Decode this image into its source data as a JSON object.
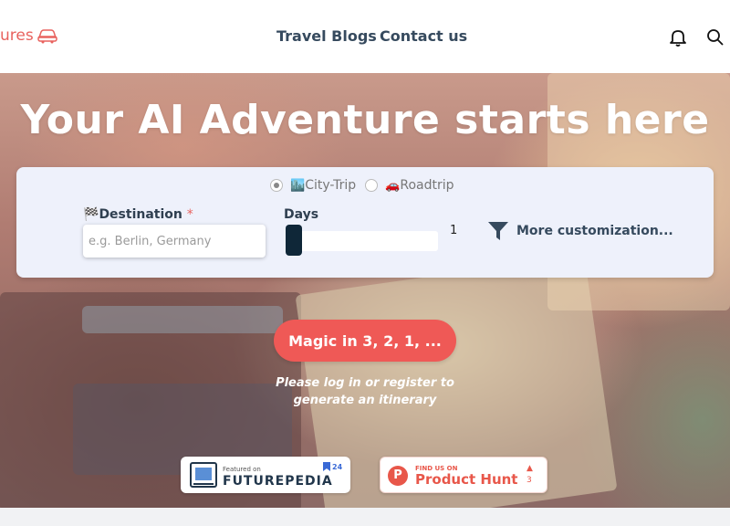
{
  "header": {
    "logo_text": "ures",
    "nav": {
      "blogs": "Travel Blogs",
      "contact": "Contact us"
    },
    "icons": [
      "bell-icon",
      "search-icon"
    ]
  },
  "hero": {
    "title": "Your AI Adventure starts here",
    "trip_type": {
      "options": [
        {
          "emoji": "🏙️",
          "label": "City-Trip",
          "selected": true
        },
        {
          "emoji": "🚗",
          "label": "Roadtrip",
          "selected": false
        }
      ]
    },
    "destination": {
      "emoji": "🏁",
      "label": "Destination",
      "required_mark": "*",
      "placeholder": "e.g. Berlin, Germany",
      "value": ""
    },
    "days": {
      "label": "Days",
      "value": "1"
    },
    "more_customization": "More customization...",
    "magic_button": "Magic in 3, 2, 1, ...",
    "login_note_line1": "Please log in or register to",
    "login_note_line2": "generate an itinerary",
    "badges": {
      "futurepedia": {
        "small": "Featured on",
        "big": "FUTUREPEDIA",
        "count": "24"
      },
      "producthunt": {
        "small": "FIND US ON",
        "big": "Product Hunt",
        "letter": "P",
        "arrow": "▲",
        "count": "3"
      }
    }
  },
  "colors": {
    "accent": "#ef5956",
    "nav_text": "#364a5e",
    "panel_bg": "#eef1fb",
    "slider_thumb": "#0f2738"
  }
}
